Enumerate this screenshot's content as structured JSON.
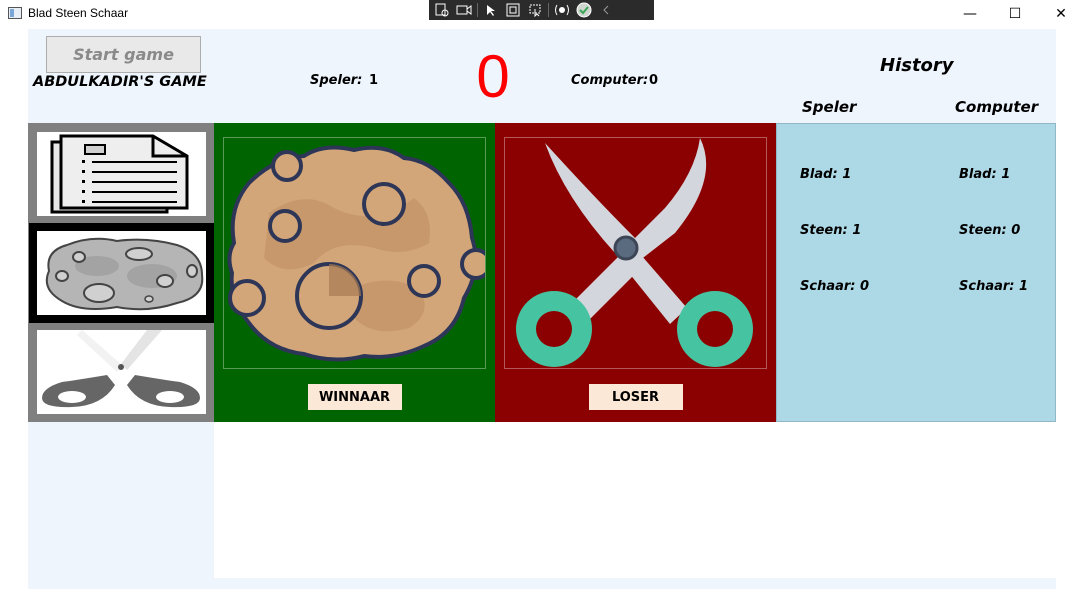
{
  "window": {
    "title": "Blad Steen Schaar",
    "minimize_glyph": "—",
    "maximize_glyph": "☐",
    "close_glyph": "✕"
  },
  "debug_toolbar": {
    "icons": [
      "live-visual-tree-icon",
      "record-icon",
      "select-element-icon",
      "display-adorners-icon",
      "track-focus-icon",
      "hot-reload-icon",
      "hot-reload-ok-icon",
      "collapse-icon"
    ]
  },
  "header": {
    "start_button": "Start game",
    "game_title": "ABDULKADIR'S GAME",
    "player_label": "Speler:",
    "player_score": "1",
    "center_score": "0",
    "computer_label": "Computer:",
    "computer_score": "0",
    "center_score_color": "#ff0000"
  },
  "history": {
    "title": "History",
    "col_player": "Speler",
    "col_computer": "Computer",
    "player": [
      {
        "label": "Blad:",
        "value": "1"
      },
      {
        "label": "Steen:",
        "value": "1"
      },
      {
        "label": "Schaar:",
        "value": "0"
      }
    ],
    "computer": [
      {
        "label": "Blad:",
        "value": "1"
      },
      {
        "label": "Steen:",
        "value": "0"
      },
      {
        "label": "Schaar:",
        "value": "1"
      }
    ],
    "background_color": "#add8e6"
  },
  "choices": [
    {
      "name": "paper-choice",
      "icon": "paper-icon",
      "selected": false
    },
    {
      "name": "rock-choice",
      "icon": "rock-icon",
      "selected": true
    },
    {
      "name": "scissors-choice",
      "icon": "scissors-icon",
      "selected": false
    }
  ],
  "player_panel": {
    "icon": "rock-icon",
    "result": "WINNAAR",
    "background_color": "#006400"
  },
  "computer_panel": {
    "icon": "scissors-icon",
    "result": "LOSER",
    "background_color": "#8b0000"
  }
}
